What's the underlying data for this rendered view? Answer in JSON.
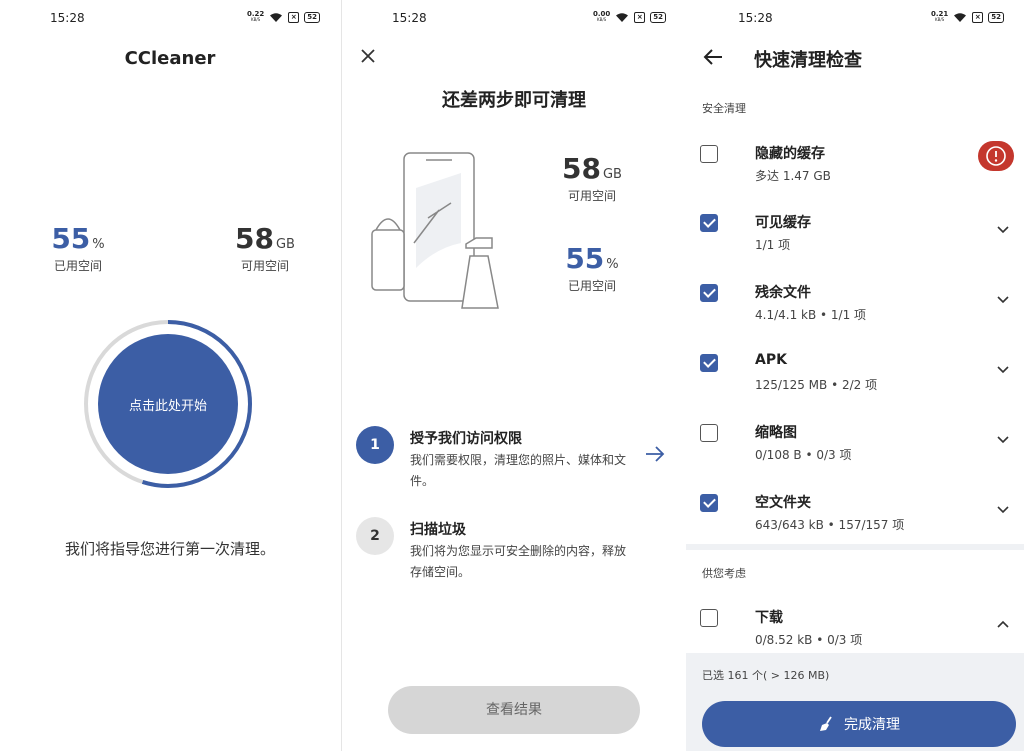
{
  "screen1": {
    "status": {
      "time": "15:28",
      "net_speed": "0.22",
      "net_unit": "KB/S",
      "battery": "52"
    },
    "title": "CCleaner",
    "used": {
      "value": "55",
      "unit": "%",
      "label": "已用空间"
    },
    "free": {
      "value": "58",
      "unit": "GB",
      "label": "可用空间"
    },
    "start_button": "点击此处开始",
    "ring_progress": 0.55,
    "guide_text": "我们将指导您进行第一次清理。"
  },
  "screen2": {
    "status": {
      "time": "15:28",
      "net_speed": "0.00",
      "net_unit": "KB/S",
      "battery": "52"
    },
    "title": "还差两步即可清理",
    "free": {
      "value": "58",
      "unit": "GB",
      "label": "可用空间"
    },
    "used": {
      "value": "55",
      "unit": "%",
      "label": "已用空间"
    },
    "steps": [
      {
        "number": "1",
        "title": "授予我们访问权限",
        "desc": "我们需要权限，清理您的照片、媒体和文件。"
      },
      {
        "number": "2",
        "title": "扫描垃圾",
        "desc": "我们将为您显示可安全删除的内容，释放存储空间。"
      }
    ],
    "view_result": "查看结果"
  },
  "screen3": {
    "status": {
      "time": "15:28",
      "net_speed": "0.21",
      "net_unit": "KB/S",
      "battery": "52"
    },
    "title": "快速清理检查",
    "section_safe": "安全清理",
    "items": [
      {
        "title": "隐藏的缓存",
        "sub": "多达 1.47 GB",
        "checked": false
      },
      {
        "title": "可见缓存",
        "sub": "1/1 项",
        "checked": true
      },
      {
        "title": "残余文件",
        "sub": "4.1/4.1 kB • 1/1 项",
        "checked": true
      },
      {
        "title": "APK",
        "sub": "125/125 MB • 2/2 项",
        "checked": true
      },
      {
        "title": "缩略图",
        "sub": "0/108 B • 0/3 项",
        "checked": false
      },
      {
        "title": "空文件夹",
        "sub": "643/643 kB • 157/157 项",
        "checked": true
      }
    ],
    "section_consider": "供您考虑",
    "consider_items": [
      {
        "title": "下载",
        "sub": "0/8.52 kB • 0/3 项",
        "checked": false
      }
    ],
    "selected_text": "已选 161 个( > 126 MB)",
    "finish_button": "完成清理"
  },
  "colors": {
    "accent": "#3c5ea5",
    "warning": "#c4372d",
    "disabled": "#d6d6d6"
  }
}
